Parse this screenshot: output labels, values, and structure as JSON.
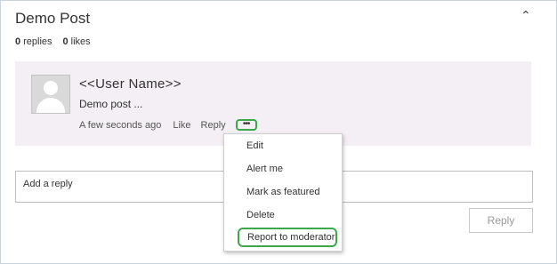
{
  "post": {
    "title": "Demo Post",
    "replies_count": "0",
    "replies_label": "replies",
    "likes_count": "0",
    "likes_label": "likes"
  },
  "comment": {
    "user_name": "<<User Name>>",
    "body": "Demo post ...",
    "timestamp": "A few seconds ago",
    "like_label": "Like",
    "reply_label": "Reply",
    "more_label": "•••"
  },
  "context_menu": {
    "items": [
      {
        "label": "Edit"
      },
      {
        "label": "Alert me"
      },
      {
        "label": "Mark as featured"
      },
      {
        "label": "Delete"
      },
      {
        "label": "Report to moderator"
      }
    ]
  },
  "reply_form": {
    "placeholder": "Add a reply",
    "value": "",
    "submit_label": "Reply"
  },
  "icons": {
    "collapse": "chevron-up-icon",
    "avatar": "user-avatar-placeholder"
  },
  "colors": {
    "highlight": "#3aa84b",
    "card_background": "#f4eff4"
  }
}
